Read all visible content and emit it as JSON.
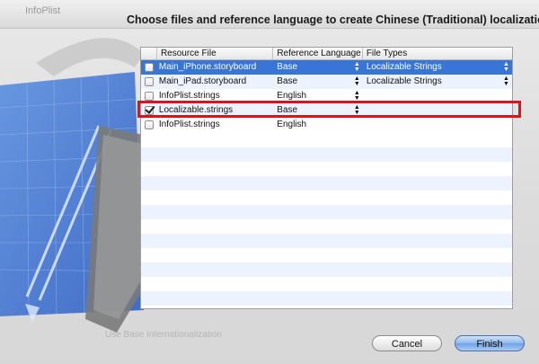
{
  "background_window": {
    "title": "InfoPlist",
    "option_label": "Use Base Internationalization"
  },
  "sheet": {
    "title": "Choose files and reference language to create Chinese (Traditional) localization"
  },
  "table": {
    "columns": [
      "",
      "Resource File",
      "Reference Language",
      "File Types"
    ],
    "rows": [
      {
        "checked": false,
        "file": "Main_iPhone.storyboard",
        "language": "Base",
        "type": "Localizable Strings",
        "selected": true,
        "language_popup": true,
        "type_popup": true
      },
      {
        "checked": false,
        "file": "Main_iPad.storyboard",
        "language": "Base",
        "type": "Localizable Strings",
        "selected": false,
        "language_popup": true,
        "type_popup": true
      },
      {
        "checked": false,
        "file": "InfoPlist.strings",
        "language": "English",
        "type": "",
        "selected": false,
        "language_popup": true,
        "type_popup": false
      },
      {
        "checked": true,
        "file": "Localizable.strings",
        "language": "Base",
        "type": "",
        "selected": false,
        "language_popup": true,
        "type_popup": false
      },
      {
        "checked": false,
        "file": "InfoPlist.strings",
        "language": "English",
        "type": "",
        "selected": false,
        "language_popup": false,
        "type_popup": false
      }
    ]
  },
  "buttons": {
    "cancel": "Cancel",
    "finish": "Finish"
  },
  "colors": {
    "selection": "#3875d7",
    "highlight": "#e3101b",
    "default_button": "#8fb7ec"
  },
  "icons": {
    "popup": "up-down-chevron-icon",
    "checkbox": "checkbox-icon"
  }
}
